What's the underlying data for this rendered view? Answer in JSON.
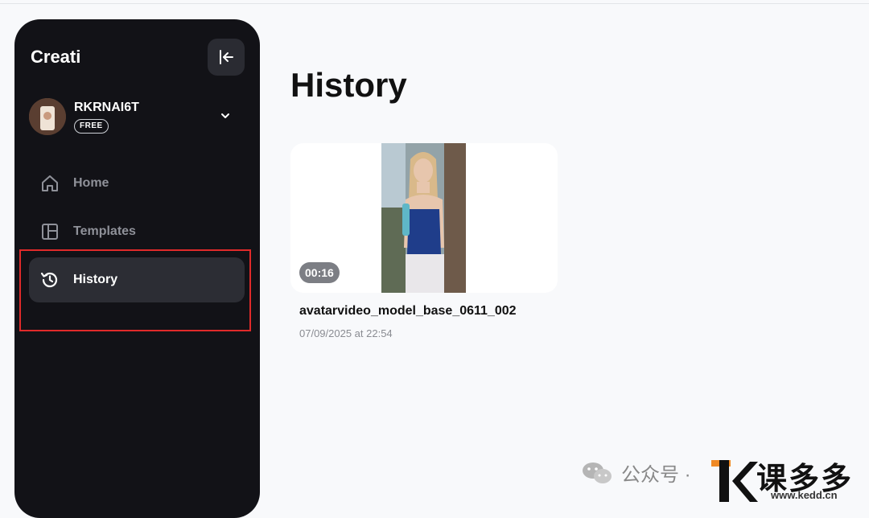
{
  "app": {
    "brand": "Creati"
  },
  "account": {
    "username": "RKRNAI6T",
    "plan": "FREE"
  },
  "sidebar": {
    "items": [
      {
        "label": "Home",
        "icon": "home-icon",
        "active": false
      },
      {
        "label": "Templates",
        "icon": "templates-icon",
        "active": false
      },
      {
        "label": "History",
        "icon": "history-icon",
        "active": true
      }
    ]
  },
  "main": {
    "title": "History",
    "videos": [
      {
        "name": "avatarvideo_model_base_0611_002",
        "date": "07/09/2025 at 22:54",
        "duration": "00:16"
      }
    ]
  },
  "watermark": {
    "wechat_label": "公众号 ·",
    "brand": "课多多",
    "url": "www.kedd.cn"
  },
  "colors": {
    "sidebar_bg": "#121217",
    "highlight": "#e02a2a",
    "page_bg": "#f8f9fb"
  }
}
